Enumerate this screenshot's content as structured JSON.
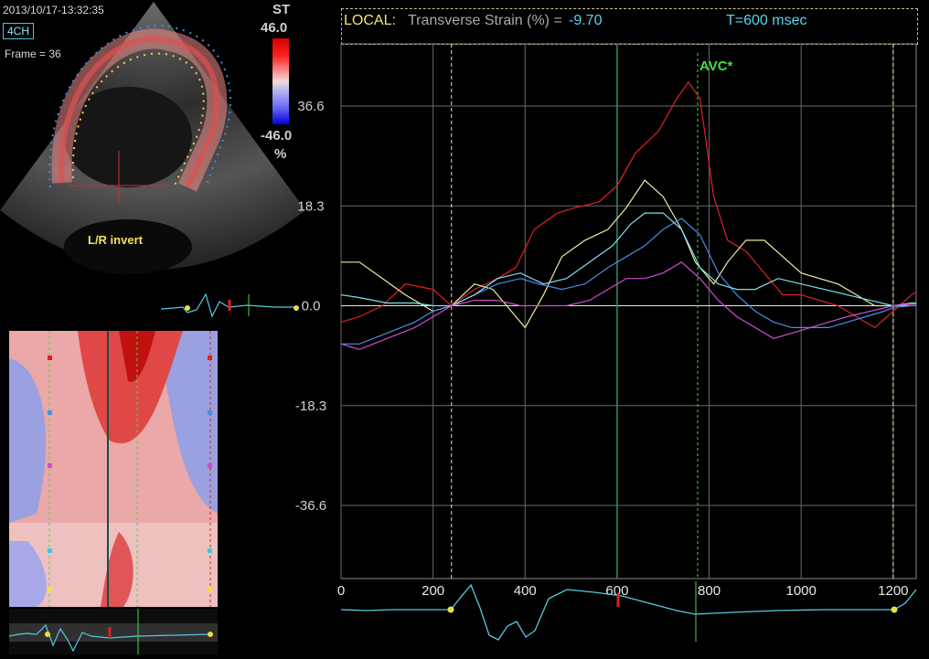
{
  "header": {
    "timestamp": "2013/10/17-13:32:35",
    "view_badge": "4CH",
    "frame_label": "Frame = 36"
  },
  "color_scale": {
    "title": "ST",
    "max_label": "46.0",
    "min_label": "-46.0",
    "unit": "%"
  },
  "image_annotation": "L/R invert",
  "graph_header": {
    "mode": "LOCAL:",
    "metric": "Transverse Strain (%) =",
    "value": "-9.70",
    "time": "T=600 msec"
  },
  "avc_label": "AVC*",
  "colors": {
    "red": "#e02222",
    "yellow": "#ececa0",
    "blue": "#4a8ee8",
    "cyan": "#7ee0ee",
    "magenta": "#d04cd0",
    "ecg": "#58c8e0",
    "avc": "#40e040"
  },
  "chart_data": {
    "type": "line",
    "xlim": [
      0,
      1250
    ],
    "ylim": [
      -50,
      48
    ],
    "x_ticks": [
      0,
      200,
      400,
      600,
      800,
      1000,
      1200
    ],
    "x_tick_labels": [
      "0",
      "200",
      "400",
      "600",
      "800",
      "1000",
      "1200"
    ],
    "y_ticks": [
      36.6,
      18.3,
      0,
      -18.3,
      -36.6
    ],
    "y_tick_labels": [
      "36.6",
      "18.3",
      "0.0",
      "-18.3",
      "-36.6"
    ],
    "markers": {
      "time_cursor": 600,
      "avc": 775,
      "cycle_start": 240,
      "cycle_end": 1200
    },
    "series": [
      {
        "color": "#e02222",
        "x": [
          0,
          40,
          90,
          140,
          200,
          240,
          290,
          340,
          380,
          420,
          470,
          510,
          560,
          600,
          640,
          690,
          730,
          755,
          780,
          810,
          840,
          880,
          920,
          960,
          1000,
          1040,
          1080,
          1120,
          1160,
          1200,
          1240,
          1250
        ],
        "y": [
          -3,
          -2,
          0,
          4,
          3,
          0,
          3,
          5,
          7,
          14,
          17,
          18,
          19,
          22,
          28,
          32,
          38,
          41,
          38,
          20,
          12,
          10,
          6,
          2,
          2,
          1,
          0,
          -2,
          -4,
          -1,
          2,
          2.5
        ]
      },
      {
        "color": "#ececa0",
        "x": [
          0,
          40,
          90,
          140,
          200,
          240,
          290,
          330,
          370,
          400,
          440,
          480,
          530,
          580,
          620,
          660,
          700,
          740,
          770,
          810,
          840,
          880,
          920,
          960,
          1000,
          1040,
          1080,
          1120,
          1160,
          1200,
          1240,
          1250
        ],
        "y": [
          8,
          8,
          5,
          2,
          -1,
          0,
          4,
          3,
          -1,
          -4,
          2,
          9,
          12,
          14,
          18,
          23,
          20,
          14,
          8,
          4,
          8,
          12,
          12,
          9,
          6,
          5,
          4,
          2,
          0,
          0,
          0.3,
          0.3
        ]
      },
      {
        "color": "#4a8ee8",
        "x": [
          0,
          40,
          100,
          160,
          200,
          240,
          290,
          340,
          390,
          430,
          480,
          530,
          580,
          620,
          660,
          700,
          740,
          780,
          820,
          860,
          900,
          940,
          980,
          1020,
          1060,
          1100,
          1140,
          1180,
          1200,
          1240,
          1250
        ],
        "y": [
          -7,
          -7,
          -5,
          -3,
          -1,
          0,
          2,
          4,
          5,
          4,
          3,
          4,
          7,
          9,
          11,
          14,
          16,
          13,
          6,
          2,
          -1,
          -3,
          -4,
          -4,
          -4,
          -3,
          -2,
          -1,
          -0.3,
          0,
          0
        ]
      },
      {
        "color": "#7ee0ee",
        "x": [
          0,
          40,
          100,
          160,
          200,
          240,
          290,
          340,
          390,
          440,
          490,
          540,
          590,
          630,
          660,
          700,
          740,
          780,
          820,
          860,
          900,
          950,
          1000,
          1050,
          1100,
          1150,
          1200,
          1240,
          1250
        ],
        "y": [
          2,
          1.5,
          0.5,
          0.5,
          0,
          0,
          2,
          5,
          6,
          4,
          5,
          8,
          11,
          15,
          17,
          17,
          14,
          7,
          4,
          3,
          3,
          5,
          4,
          3,
          2,
          1,
          0,
          0.5,
          0.5
        ]
      },
      {
        "color": "#d04cd0",
        "x": [
          0,
          40,
          100,
          160,
          200,
          240,
          290,
          340,
          390,
          440,
          490,
          540,
          580,
          620,
          660,
          700,
          740,
          780,
          820,
          860,
          900,
          940,
          980,
          1020,
          1060,
          1100,
          1150,
          1200,
          1240,
          1250
        ],
        "y": [
          -7,
          -8,
          -6,
          -4,
          -2,
          0,
          1,
          1,
          0,
          0,
          0,
          1,
          3,
          5,
          5,
          6,
          8,
          5,
          1,
          -2,
          -4,
          -6,
          -5,
          -4,
          -3,
          -2,
          -1,
          0,
          0.3,
          0.3
        ]
      }
    ]
  }
}
